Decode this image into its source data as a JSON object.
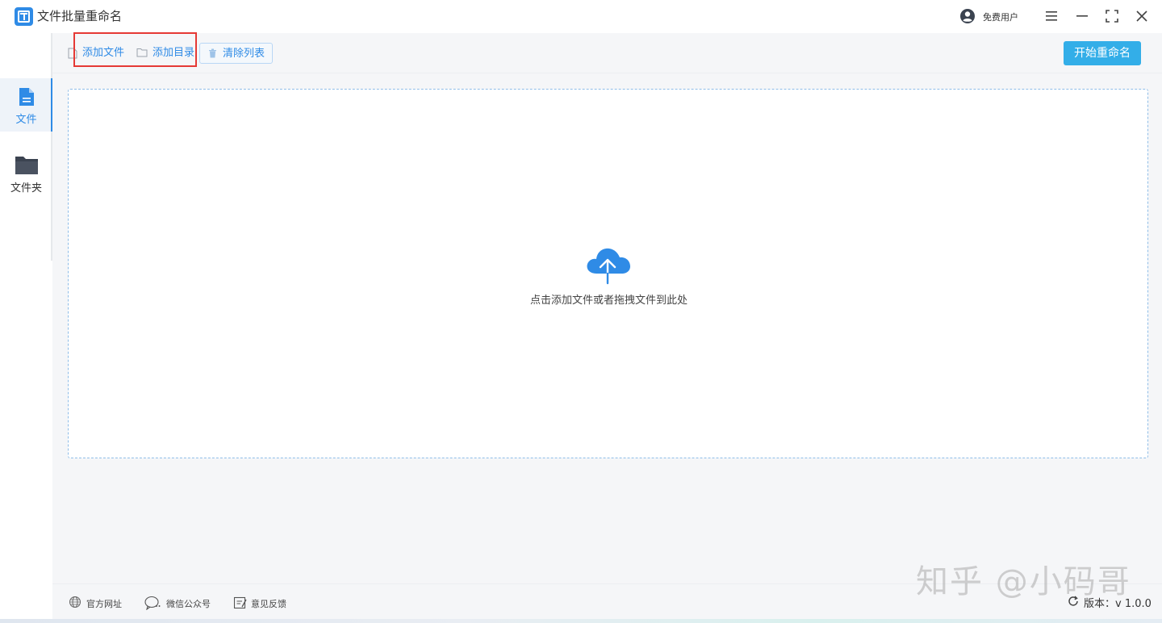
{
  "app": {
    "title": "文件批量重命名",
    "user_label": "免费用户"
  },
  "icons": {
    "logo": "app-logo-icon",
    "user": "user-circle-icon",
    "menu": "hamburger-menu-icon",
    "minimize": "minimize-icon",
    "maximize": "maximize-icon",
    "close": "close-icon",
    "file": "file-icon",
    "folder": "folder-icon",
    "trash": "trash-icon",
    "cloud_upload": "cloud-upload-icon",
    "globe": "globe-icon",
    "wechat": "wechat-icon",
    "feedback": "feedback-icon",
    "refresh": "refresh-icon"
  },
  "sidebar": {
    "items": [
      {
        "label": "文件",
        "active": true
      },
      {
        "label": "文件夹",
        "active": false
      }
    ]
  },
  "toolbar": {
    "add_file": "添加文件",
    "add_folder": "添加目录",
    "clear_list": "清除列表",
    "start_rename": "开始重命名"
  },
  "dropzone": {
    "hint": "点击添加文件或者拖拽文件到此处"
  },
  "footer": {
    "website": "官方网址",
    "wechat": "微信公众号",
    "feedback": "意见反馈",
    "version": "版本：v 1.0.0"
  },
  "watermark": "知乎 @小码哥",
  "colors": {
    "accent": "#2f8be6",
    "start_button": "#33aee8",
    "highlight": "#e53935"
  }
}
